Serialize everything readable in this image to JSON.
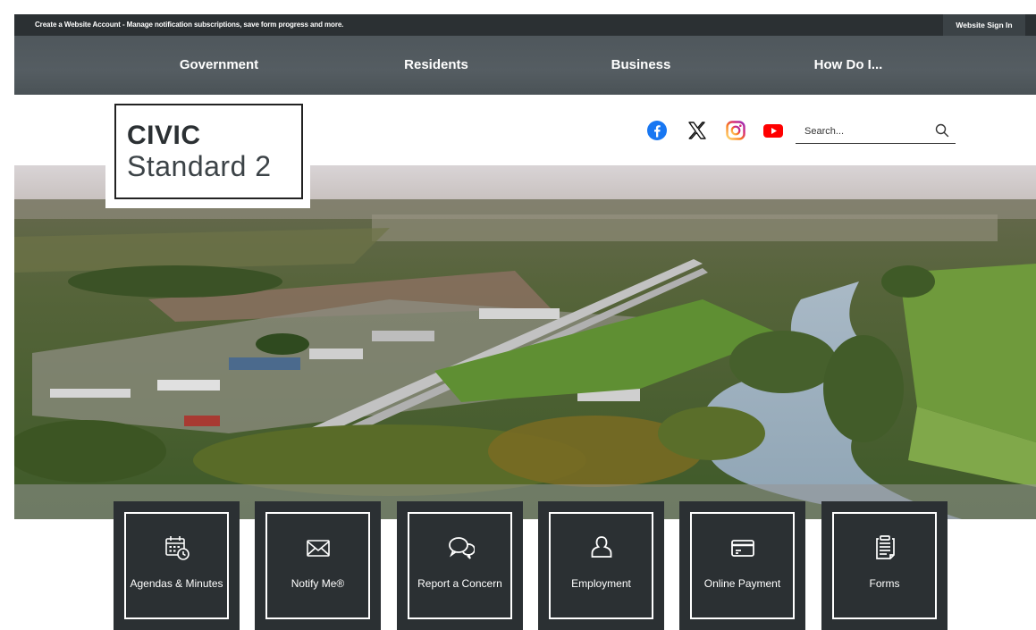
{
  "topbar": {
    "account_text": "Create a Website Account - Manage notification subscriptions, save form progress and more.",
    "signin_label": "Website Sign In"
  },
  "nav": {
    "items": [
      {
        "label": "Government"
      },
      {
        "label": "Residents"
      },
      {
        "label": "Business"
      },
      {
        "label": "How Do I..."
      }
    ]
  },
  "logo": {
    "line1": "CIVIC",
    "line2": "Standard 2"
  },
  "social": {
    "icons": [
      "facebook-icon",
      "x-icon",
      "instagram-icon",
      "youtube-icon"
    ],
    "colors": {
      "facebook": "#1877f2",
      "x": "#111111",
      "instagram": "#d62976",
      "youtube": "#ff0000"
    }
  },
  "search": {
    "placeholder": "Search..."
  },
  "quick_links": [
    {
      "label": "Agendas & Minutes",
      "icon": "calendar-clock-icon"
    },
    {
      "label": "Notify Me®",
      "icon": "envelope-icon"
    },
    {
      "label": "Report a Concern",
      "icon": "speech-bubbles-icon"
    },
    {
      "label": "Employment",
      "icon": "person-icon"
    },
    {
      "label": "Online Payment",
      "icon": "credit-card-icon"
    },
    {
      "label": "Forms",
      "icon": "document-stack-icon"
    }
  ],
  "colors": {
    "dark": "#2b3033",
    "nav": "#52595e",
    "white": "#ffffff"
  }
}
